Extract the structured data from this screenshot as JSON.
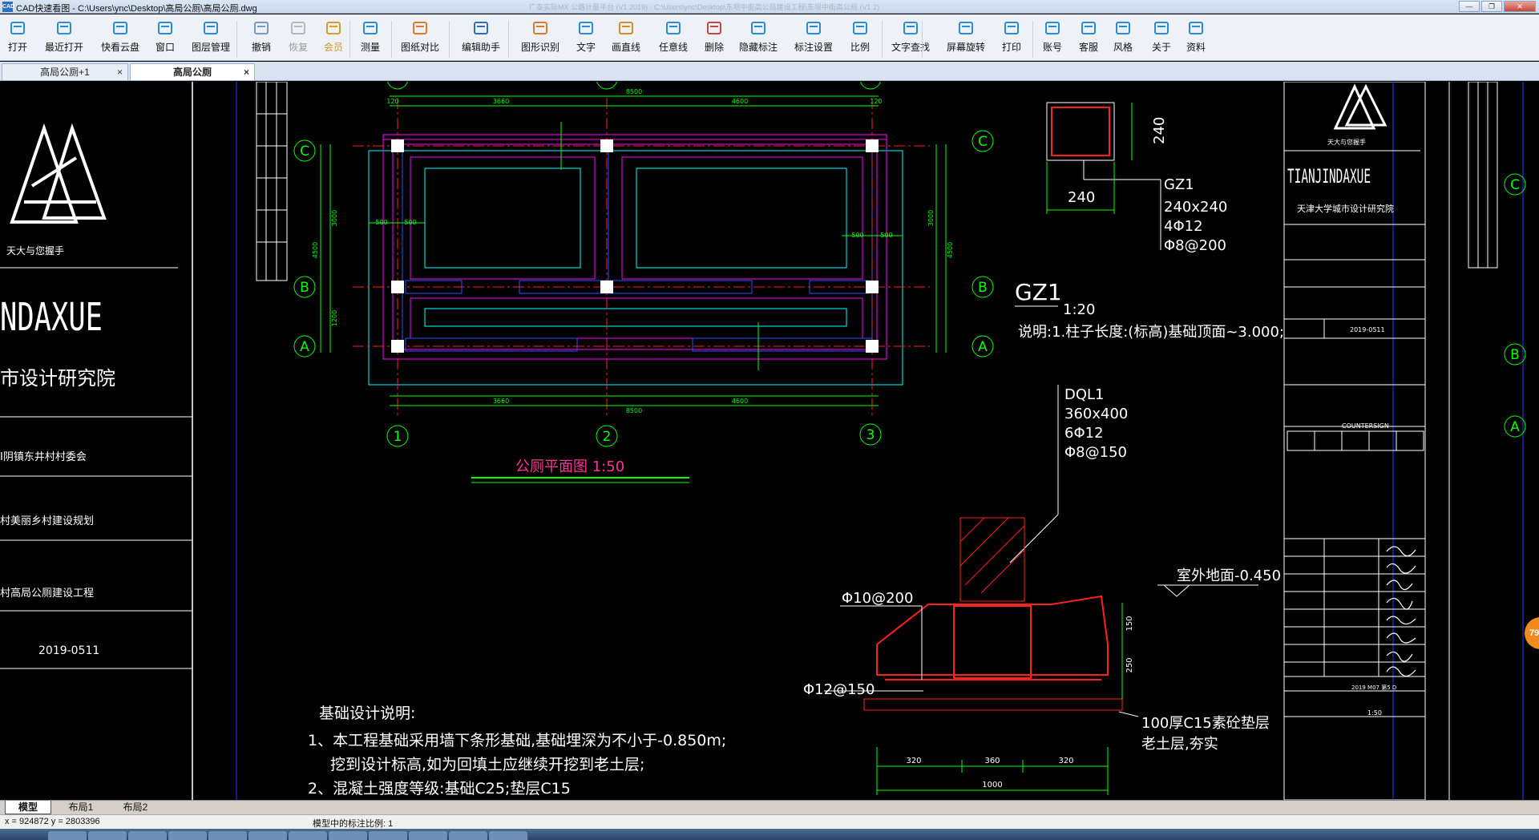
{
  "window": {
    "app_badge": "CAD",
    "title": "CAD快速看图 - C:\\Users\\ync\\Desktop\\高局公厕\\高局公厕.dwg",
    "ghost_text": "广泰实际MX 公路计量平台 (V1 2019) - C:\\Users\\ync\\Desktop\\东坝中街高公局建设工程\\东坝中街高公局 (V1 2)"
  },
  "toolbar": {
    "items": [
      {
        "label": "打开",
        "icon": "folder-open-icon"
      },
      {
        "label": "最近打开",
        "icon": "recent-clock-icon"
      },
      {
        "label": "快看云盘",
        "icon": "cloud-icon"
      },
      {
        "label": "窗口",
        "icon": "window-icon"
      },
      {
        "label": "图层管理",
        "icon": "layers-icon"
      },
      {
        "label": "撤销",
        "icon": "undo-icon"
      },
      {
        "label": "恢复",
        "icon": "redo-icon"
      },
      {
        "label": "会员",
        "icon": "vip-icon"
      },
      {
        "label": "测量",
        "icon": "ruler-icon"
      },
      {
        "label": "图纸对比",
        "icon": "compare-icon"
      },
      {
        "label": "编辑助手",
        "icon": "edit-assistant-icon"
      },
      {
        "label": "图形识别",
        "icon": "shape-recognize-icon"
      },
      {
        "label": "文字",
        "icon": "text-icon"
      },
      {
        "label": "画直线",
        "icon": "line-icon"
      },
      {
        "label": "任意线",
        "icon": "freehand-icon"
      },
      {
        "label": "删除",
        "icon": "eraser-icon"
      },
      {
        "label": "隐藏标注",
        "icon": "hide-annotation-icon"
      },
      {
        "label": "标注设置",
        "icon": "annotation-settings-icon"
      },
      {
        "label": "比例",
        "icon": "scale-icon"
      },
      {
        "label": "文字查找",
        "icon": "text-search-icon"
      },
      {
        "label": "屏幕旋转",
        "icon": "rotate-screen-icon"
      },
      {
        "label": "打印",
        "icon": "printer-icon"
      },
      {
        "label": "账号",
        "icon": "account-icon"
      },
      {
        "label": "客服",
        "icon": "headset-icon"
      },
      {
        "label": "风格",
        "icon": "style-icon"
      },
      {
        "label": "关于",
        "icon": "info-icon"
      },
      {
        "label": "资料",
        "icon": "docs-icon"
      }
    ]
  },
  "doc_tabs": [
    {
      "label": "高局公厕+1",
      "close": "×",
      "active": false
    },
    {
      "label": "高局公厕",
      "close": "×",
      "active": true
    }
  ],
  "drawing": {
    "left_block": {
      "company": "天大与您握手",
      "university": "NDAXUE",
      "institute": "市设计研究院",
      "client": "I阴镇东井村村委会",
      "project_a": "村美丽乡村建设规划",
      "project_b": "村高局公厕建设工程",
      "date": "2019-0511"
    },
    "plan": {
      "title": "公厕平面图 1:50",
      "total_width": "8500",
      "bay_left": "3660",
      "bay_right": "4600",
      "edge_dim": "120",
      "depth_total": "4500",
      "depth_upper": "3000",
      "depth_lower": "1200",
      "side_dim": "500",
      "axis_letters": [
        "C",
        "B",
        "A"
      ],
      "axis_numbers": [
        "1",
        "2",
        "3"
      ]
    },
    "column": {
      "label": "GZ1",
      "scale": "1:20",
      "height_dim": "240",
      "width_dim": "240",
      "tag": "GZ1",
      "size": "240x240",
      "rebar_main": "4Φ12",
      "rebar_stirrup": "Φ8@200",
      "note": "说明:1.柱子长度:(标高)基础顶面~3.000;"
    },
    "footing": {
      "tag": "DQL1",
      "size": "360x400",
      "rebar_main": "6Φ12",
      "rebar_stirrup": "Φ8@150",
      "ground": "室外地面-0.450",
      "rebar_top": "Φ10@200",
      "rebar_bottom": "Φ12@150",
      "cushion": "100厚C15素砼垫层",
      "soil": "老土层,夯实",
      "dim_left": "320",
      "dim_mid": "360",
      "dim_right": "320",
      "dim_total": "1000",
      "dim_h1": "150",
      "dim_h2": "250"
    },
    "notes": {
      "heading": "基础设计说明:",
      "line1": "1、本工程基础采用墙下条形基础,基础埋深为不小于-0.850m;",
      "line2": "挖到设计标高,如为回填土应继续开挖到老土层;",
      "line3": "2、混凝土强度等级:基础C25;垫层C15"
    },
    "right_block": {
      "company": "天大与您握手",
      "university": "TIANJINDAXUE",
      "institute": "天津大学城市设计研究院",
      "date": "2019-0511",
      "countersign": "COUNTERSIGN",
      "year_row": "2019  M07  第5  D",
      "scale_note": "1:50"
    }
  },
  "layout_tabs": [
    "模型",
    "布局1",
    "布局2"
  ],
  "status": {
    "coords": "x = 924872  y = 2803396",
    "scale": "模型中的标注比例: 1"
  },
  "bubble": "79",
  "colors": {
    "cad_green": "#00ff00",
    "cad_cyan": "#00ffff",
    "cad_magenta": "#ff00ff",
    "cad_red": "#ff2020",
    "cad_blue": "#3050ff",
    "cad_white": "#ffffff",
    "cad_yellow": "#ffff00",
    "cad_pink": "#ff3399"
  }
}
